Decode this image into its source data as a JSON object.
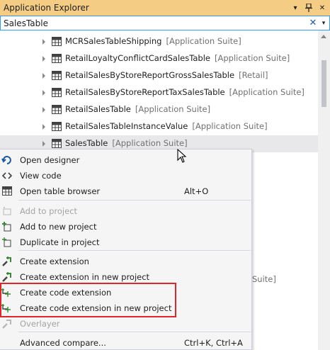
{
  "window": {
    "title": "Application Explorer",
    "pin_glyph": "▾",
    "autohide_glyph": "⫧",
    "close_glyph": "✕"
  },
  "search": {
    "value": "SalesTable",
    "clear_glyph": "✕",
    "dropdown_glyph": "▾"
  },
  "tree": {
    "items": [
      {
        "name": "MCRSalesTableShipping",
        "model": "[Application Suite]"
      },
      {
        "name": "RetailLoyaltyConflictCardSalesTable",
        "model": "[Application Suite]"
      },
      {
        "name": "RetailSalesByStoreReportGrossSalesTable",
        "model": "[Retail]"
      },
      {
        "name": "RetailSalesByStoreReportTaxSalesTable",
        "model": "[Application Suite]"
      },
      {
        "name": "RetailSalesTable",
        "model": "[Application Suite]"
      },
      {
        "name": "RetailSalesTableInstanceValue",
        "model": "[Application Suite]"
      },
      {
        "name": "SalesTable",
        "model": "[Application Suite]",
        "selected": true
      }
    ],
    "partial_text": "Suite]"
  },
  "context_menu": {
    "items": [
      {
        "label": "Open designer",
        "icon": "open-designer-icon"
      },
      {
        "label": "View code",
        "icon": "view-code-icon"
      },
      {
        "label": "Open table browser",
        "shortcut": "Alt+O",
        "icon": "table-browser-icon"
      },
      {
        "label": "Add to project",
        "icon": "add-to-project-icon",
        "disabled": true
      },
      {
        "label": "Add to new project",
        "icon": "add-to-new-project-icon"
      },
      {
        "label": "Duplicate in project",
        "icon": "duplicate-icon"
      },
      {
        "label": "Create extension",
        "icon": "extension-icon"
      },
      {
        "label": "Create extension in new project",
        "icon": "extension-icon"
      },
      {
        "label": "Create code extension",
        "icon": "code-extension-icon"
      },
      {
        "label": "Create code extension in new project",
        "icon": "code-extension-icon"
      },
      {
        "label": "Overlayer",
        "icon": "overlayer-icon",
        "disabled": true
      },
      {
        "label": "Advanced compare...",
        "shortcut": "Ctrl+K, Ctrl+A"
      }
    ]
  },
  "colors": {
    "titlebar": "#f5cc84",
    "selection": "#e8e8ea",
    "highlight_box": "#e0262b",
    "accent": "#3399ff"
  }
}
